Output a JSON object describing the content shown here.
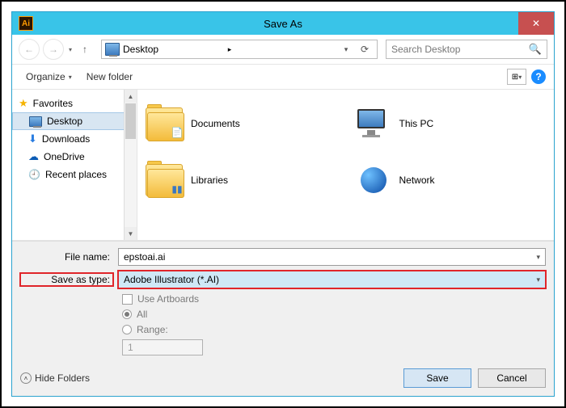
{
  "titlebar": {
    "app_icon_text": "Ai",
    "title": "Save As"
  },
  "nav": {
    "location_icon_label": "Desktop",
    "location_text": "Desktop",
    "separator": "▸",
    "search_placeholder": "Search Desktop"
  },
  "toolbar": {
    "organize": "Organize",
    "newfolder": "New folder"
  },
  "sidebar": {
    "heading": "Favorites",
    "items": [
      {
        "label": "Desktop"
      },
      {
        "label": "Downloads"
      },
      {
        "label": "OneDrive"
      },
      {
        "label": "Recent places"
      }
    ]
  },
  "grid": {
    "items": [
      {
        "label": "Documents"
      },
      {
        "label": "This PC"
      },
      {
        "label": "Libraries"
      },
      {
        "label": "Network"
      }
    ]
  },
  "form": {
    "filename_label": "File name:",
    "filename_value": "epstoai.ai",
    "savetype_label": "Save as type:",
    "savetype_value": "Adobe Illustrator (*.AI)",
    "use_artboards": "Use Artboards",
    "opt_all": "All",
    "opt_range": "Range:",
    "range_value": "1"
  },
  "footer": {
    "hide_folders": "Hide Folders",
    "save": "Save",
    "cancel": "Cancel"
  }
}
